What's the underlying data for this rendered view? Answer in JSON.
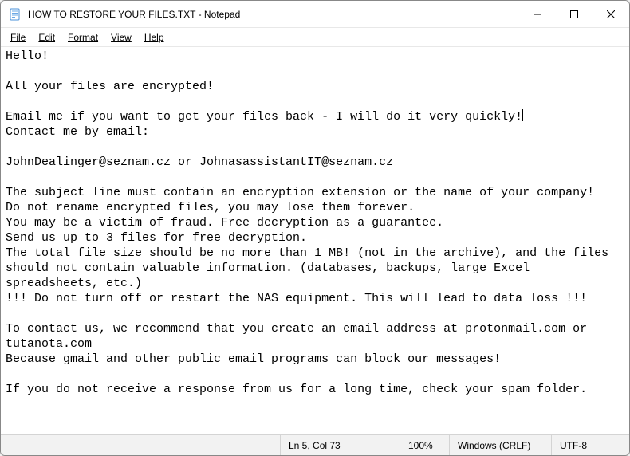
{
  "titlebar": {
    "title": "HOW TO RESTORE YOUR FILES.TXT - Notepad"
  },
  "menu": {
    "file": "File",
    "edit": "Edit",
    "format": "Format",
    "view": "View",
    "help": "Help"
  },
  "content": {
    "before_caret": "Hello!\n\nAll your files are encrypted!\n\nEmail me if you want to get your files back - I will do it very quickly!",
    "after_caret": "\nContact me by email:\n\nJohnDealinger@seznam.cz or JohnasassistantIT@seznam.cz\n\nThe subject line must contain an encryption extension or the name of your company!\nDo not rename encrypted files, you may lose them forever.\nYou may be a victim of fraud. Free decryption as a guarantee.\nSend us up to 3 files for free decryption.\nThe total file size should be no more than 1 MB! (not in the archive), and the files should not contain valuable information. (databases, backups, large Excel spreadsheets, etc.)\n!!! Do not turn off or restart the NAS equipment. This will lead to data loss !!!\n\nTo contact us, we recommend that you create an email address at protonmail.com or tutanota.com\nBecause gmail and other public email programs can block our messages!\n\nIf you do not receive a response from us for a long time, check your spam folder."
  },
  "status": {
    "position": "Ln 5, Col 73",
    "zoom": "100%",
    "eol": "Windows (CRLF)",
    "encoding": "UTF-8"
  }
}
